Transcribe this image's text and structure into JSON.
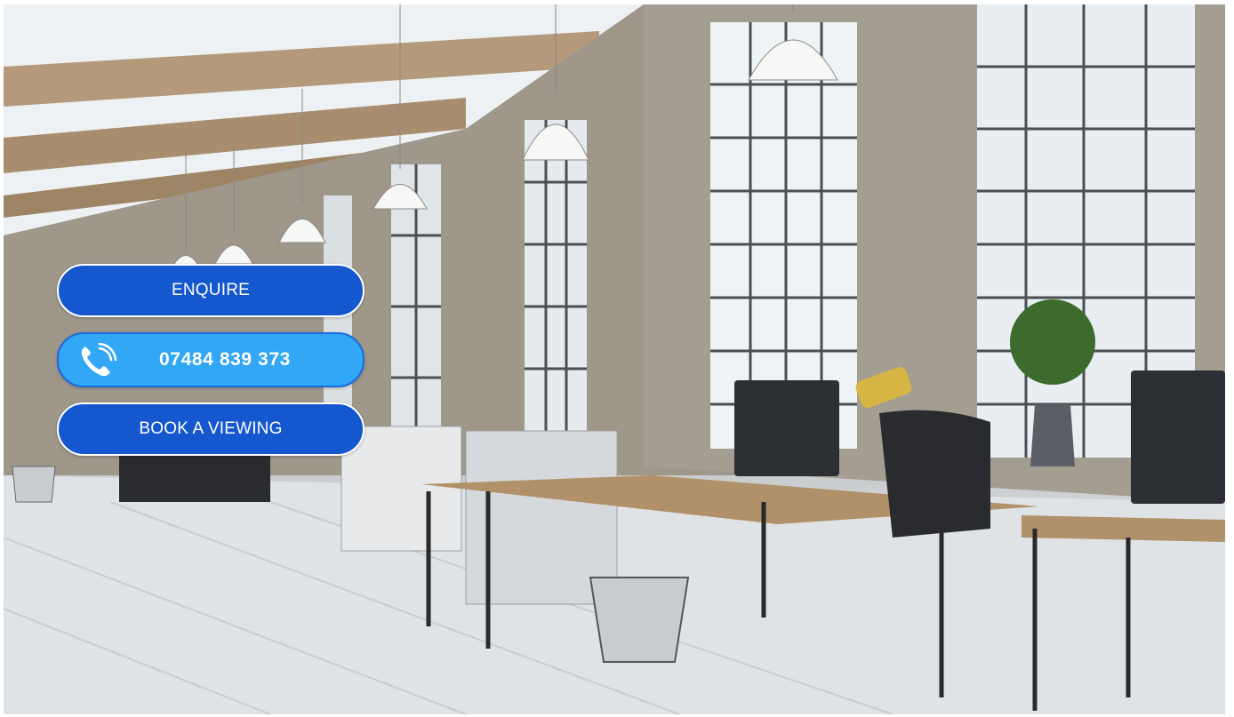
{
  "hero": {
    "image": "loft-office-interior"
  },
  "actions": {
    "enquire_label": "ENQUIRE",
    "phone_number": "07484 839 373",
    "phone_icon": "phone-handset-icon",
    "book_viewing_label": "BOOK A VIEWING"
  },
  "colors": {
    "primary_button": "#1557cf",
    "phone_button": "#31a7f6",
    "button_text": "#ffffff"
  }
}
